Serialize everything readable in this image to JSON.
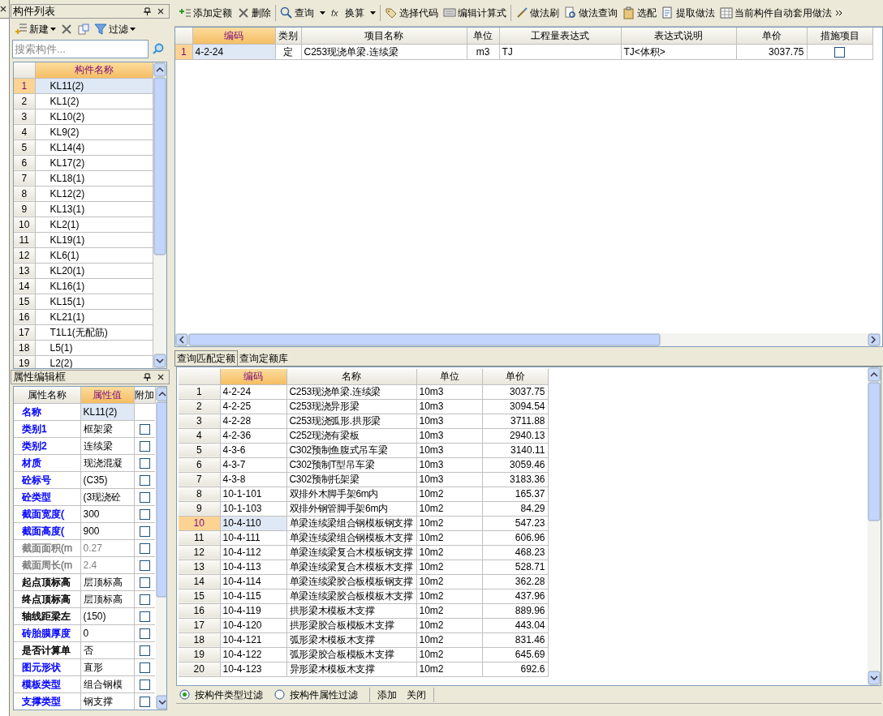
{
  "component_list": {
    "title": "构件列表",
    "toolbar": [
      {
        "kind": "new",
        "label": "新建",
        "dropdown": true
      },
      {
        "kind": "delete"
      },
      {
        "kind": "copy"
      },
      {
        "kind": "filter",
        "label": "过滤",
        "dropdown": true
      }
    ],
    "search": {
      "placeholder": "搜索构件..."
    },
    "column": "构件名称",
    "rows": [
      {
        "num": "1",
        "name": "KL11(2)",
        "selected": true
      },
      {
        "num": "2",
        "name": "KL1(2)",
        "selected": false
      },
      {
        "num": "3",
        "name": "KL10(2)",
        "selected": false
      },
      {
        "num": "4",
        "name": "KL9(2)",
        "selected": false
      },
      {
        "num": "5",
        "name": "KL14(4)",
        "selected": false
      },
      {
        "num": "6",
        "name": "KL17(2)",
        "selected": false
      },
      {
        "num": "7",
        "name": "KL18(1)",
        "selected": false
      },
      {
        "num": "8",
        "name": "KL12(2)",
        "selected": false
      },
      {
        "num": "9",
        "name": "KL13(1)",
        "selected": false
      },
      {
        "num": "10",
        "name": "KL2(1)",
        "selected": false
      },
      {
        "num": "11",
        "name": "KL19(1)",
        "selected": false
      },
      {
        "num": "12",
        "name": "KL6(1)",
        "selected": false
      },
      {
        "num": "13",
        "name": "KL20(1)",
        "selected": false
      },
      {
        "num": "14",
        "name": "KL16(1)",
        "selected": false
      },
      {
        "num": "15",
        "name": "KL15(1)",
        "selected": false
      },
      {
        "num": "16",
        "name": "KL21(1)",
        "selected": false
      },
      {
        "num": "17",
        "name": "T1L1(无配筋)",
        "selected": false
      },
      {
        "num": "18",
        "name": "L5(1)",
        "selected": false
      },
      {
        "num": "19",
        "name": "L2(2)",
        "selected": false
      }
    ]
  },
  "property_editor": {
    "title": "属性编辑框",
    "columns": [
      {
        "label": "属性名称",
        "active": false
      },
      {
        "label": "属性值",
        "active": true
      },
      {
        "label": "附加",
        "active": false
      }
    ],
    "rows": [
      {
        "name": "名称",
        "value": "KL11(2)",
        "color": "#0000ff",
        "selected": true
      },
      {
        "name": "类别1",
        "value": "框架梁",
        "color": "#0000ff",
        "checked": false
      },
      {
        "name": "类别2",
        "value": "连续梁",
        "color": "#0000ff",
        "checked": false
      },
      {
        "name": "材质",
        "value": "现浇混凝",
        "color": "#0000ff",
        "checked": false
      },
      {
        "name": "砼标号",
        "value": "(C35)",
        "color": "#0000ff",
        "checked": false
      },
      {
        "name": "砼类型",
        "value": "(3现浇砼",
        "color": "#0000ff",
        "checked": false
      },
      {
        "name": "截面宽度(",
        "value": "300",
        "color": "#0000ff",
        "checked": false
      },
      {
        "name": "截面高度(",
        "value": "900",
        "color": "#0000ff",
        "checked": false
      },
      {
        "name": "截面面积(m",
        "value": "0.27",
        "color": "#808080",
        "checked": false
      },
      {
        "name": "截面周长(m",
        "value": "2.4",
        "color": "#808080",
        "checked": false
      },
      {
        "name": "起点顶标高",
        "value": "层顶标高",
        "color": "#000000",
        "checked": false
      },
      {
        "name": "终点顶标高",
        "value": "层顶标高",
        "color": "#000000",
        "checked": false
      },
      {
        "name": "轴线距梁左",
        "value": "(150)",
        "color": "#000000",
        "checked": false
      },
      {
        "name": "砖胎膜厚度",
        "value": "0",
        "color": "#0000ff",
        "checked": false
      },
      {
        "name": "是否计算单",
        "value": "否",
        "color": "#000000",
        "checked": false
      },
      {
        "name": "图元形状",
        "value": "直形",
        "color": "#0000ff",
        "checked": false
      },
      {
        "name": "模板类型",
        "value": "组合钢模",
        "color": "#0000ff",
        "checked": false
      },
      {
        "name": "支撑类型",
        "value": "钢支撑",
        "color": "#0000ff",
        "checked": false
      }
    ]
  },
  "toolbar": [
    {
      "kind": "add",
      "label": "添加定额"
    },
    {
      "kind": "delete",
      "label": "删除"
    },
    {
      "kind": "search",
      "label": "查询",
      "dropdown": true
    },
    {
      "kind": "fx",
      "label": "换算",
      "dropdown": true
    },
    {
      "kind": "code",
      "label": "选择代码"
    },
    {
      "kind": "edit",
      "label": "编辑计算式"
    },
    {
      "kind": "brush",
      "label": "做法刷"
    },
    {
      "kind": "lookup",
      "label": "做法查询"
    },
    {
      "kind": "match",
      "label": "选配"
    },
    {
      "kind": "extract",
      "label": "提取做法"
    },
    {
      "kind": "auto",
      "label": "当前构件自动套用做法"
    }
  ],
  "quota_table": {
    "columns": [
      {
        "label": "编码",
        "active": true
      },
      {
        "label": "类别",
        "active": false
      },
      {
        "label": "项目名称",
        "active": false
      },
      {
        "label": "单位",
        "active": false
      },
      {
        "label": "工程量表达式",
        "active": false
      },
      {
        "label": "表达式说明",
        "active": false
      },
      {
        "label": "单价",
        "active": false
      },
      {
        "label": "措施项目",
        "active": false
      }
    ],
    "rows": [
      {
        "num": "1",
        "code": "4-2-24",
        "type": "定",
        "name": "C253现浇单梁.连续梁",
        "unit": "m3",
        "expression": "TJ",
        "explanation": "TJ<体积>",
        "price": "3037.75",
        "measure": false,
        "selected": true
      }
    ]
  },
  "lower_tabs": [
    {
      "label": "查询匹配定额",
      "selected": true
    },
    {
      "label": "查询定额库",
      "selected": false
    }
  ],
  "results": {
    "columns": [
      {
        "label": "编码",
        "active": true
      },
      {
        "label": "名称",
        "active": false
      },
      {
        "label": "单位",
        "active": false
      },
      {
        "label": "单价",
        "active": false
      }
    ],
    "rows": [
      {
        "num": "1",
        "code": "4-2-24",
        "name": "C253现浇单梁.连续梁",
        "unit": "10m3",
        "price": "3037.75",
        "selected": false
      },
      {
        "num": "2",
        "code": "4-2-25",
        "name": "C253现浇异形梁",
        "unit": "10m3",
        "price": "3094.54",
        "selected": false
      },
      {
        "num": "3",
        "code": "4-2-28",
        "name": "C253现浇弧形.拱形梁",
        "unit": "10m3",
        "price": "3711.88",
        "selected": false
      },
      {
        "num": "4",
        "code": "4-2-36",
        "name": "C252现浇有梁板",
        "unit": "10m3",
        "price": "2940.13",
        "selected": false
      },
      {
        "num": "5",
        "code": "4-3-6",
        "name": "C302预制鱼腹式吊车梁",
        "unit": "10m3",
        "price": "3140.11",
        "selected": false
      },
      {
        "num": "6",
        "code": "4-3-7",
        "name": "C302预制T型吊车梁",
        "unit": "10m3",
        "price": "3059.46",
        "selected": false
      },
      {
        "num": "7",
        "code": "4-3-8",
        "name": "C302预制托架梁",
        "unit": "10m3",
        "price": "3183.36",
        "selected": false
      },
      {
        "num": "8",
        "code": "10-1-101",
        "name": "双排外木脚手架6m内",
        "unit": "10m2",
        "price": "165.37",
        "selected": false
      },
      {
        "num": "9",
        "code": "10-1-103",
        "name": "双排外钢管脚手架6m内",
        "unit": "10m2",
        "price": "84.29",
        "selected": false
      },
      {
        "num": "10",
        "code": "10-4-110",
        "name": "单梁连续梁组合钢模板钢支撑",
        "unit": "10m2",
        "price": "547.23",
        "selected": true
      },
      {
        "num": "11",
        "code": "10-4-111",
        "name": "单梁连续梁组合钢模板木支撑",
        "unit": "10m2",
        "price": "606.96",
        "selected": false
      },
      {
        "num": "12",
        "code": "10-4-112",
        "name": "单梁连续梁复合木模板钢支撑",
        "unit": "10m2",
        "price": "468.23",
        "selected": false
      },
      {
        "num": "13",
        "code": "10-4-113",
        "name": "单梁连续梁复合木模板木支撑",
        "unit": "10m2",
        "price": "528.71",
        "selected": false
      },
      {
        "num": "14",
        "code": "10-4-114",
        "name": "单梁连续梁胶合板模板钢支撑",
        "unit": "10m2",
        "price": "362.28",
        "selected": false
      },
      {
        "num": "15",
        "code": "10-4-115",
        "name": "单梁连续梁胶合板模板木支撑",
        "unit": "10m2",
        "price": "437.96",
        "selected": false
      },
      {
        "num": "16",
        "code": "10-4-119",
        "name": "拱形梁木模板木支撑",
        "unit": "10m2",
        "price": "889.96",
        "selected": false
      },
      {
        "num": "17",
        "code": "10-4-120",
        "name": "拱形梁胶合板模板木支撑",
        "unit": "10m2",
        "price": "443.04",
        "selected": false
      },
      {
        "num": "18",
        "code": "10-4-121",
        "name": "弧形梁木模板木支撑",
        "unit": "10m2",
        "price": "831.46",
        "selected": false
      },
      {
        "num": "19",
        "code": "10-4-122",
        "name": "弧形梁胶合板模板木支撑",
        "unit": "10m2",
        "price": "645.69",
        "selected": false
      },
      {
        "num": "20",
        "code": "10-4-123",
        "name": "异形梁木模板木支撑",
        "unit": "10m2",
        "price": "692.6",
        "selected": false
      }
    ]
  },
  "filter_options": [
    {
      "label": "按构件类型过滤",
      "selected": true
    },
    {
      "label": "按构件属性过滤",
      "selected": false
    }
  ],
  "buttons": [
    "添加",
    "关闭"
  ]
}
